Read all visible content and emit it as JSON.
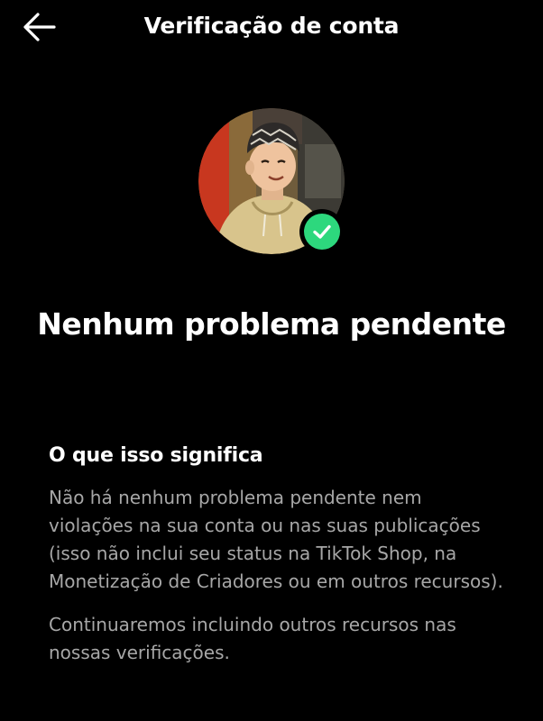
{
  "header": {
    "title": "Verificação de conta",
    "back_icon": "back-arrow-icon"
  },
  "profile": {
    "avatar": "avatar",
    "badge_icon": "check-icon",
    "badge_color": "#2dd87d"
  },
  "status": {
    "headline": "Nenhum problema pendente"
  },
  "info": {
    "heading": "O que isso significa",
    "paragraph_1": "Não há nenhum problema pendente nem violações na sua conta ou nas suas publicações (isso não inclui seu status na TikTok Shop, na Monetização de Criadores ou em outros recursos).",
    "paragraph_2": "Continuaremos incluindo outros recursos nas nossas verificações."
  },
  "colors": {
    "background": "#000000",
    "text_primary": "#ffffff",
    "text_secondary": "#a7a7a7",
    "accent": "#2dd87d"
  }
}
